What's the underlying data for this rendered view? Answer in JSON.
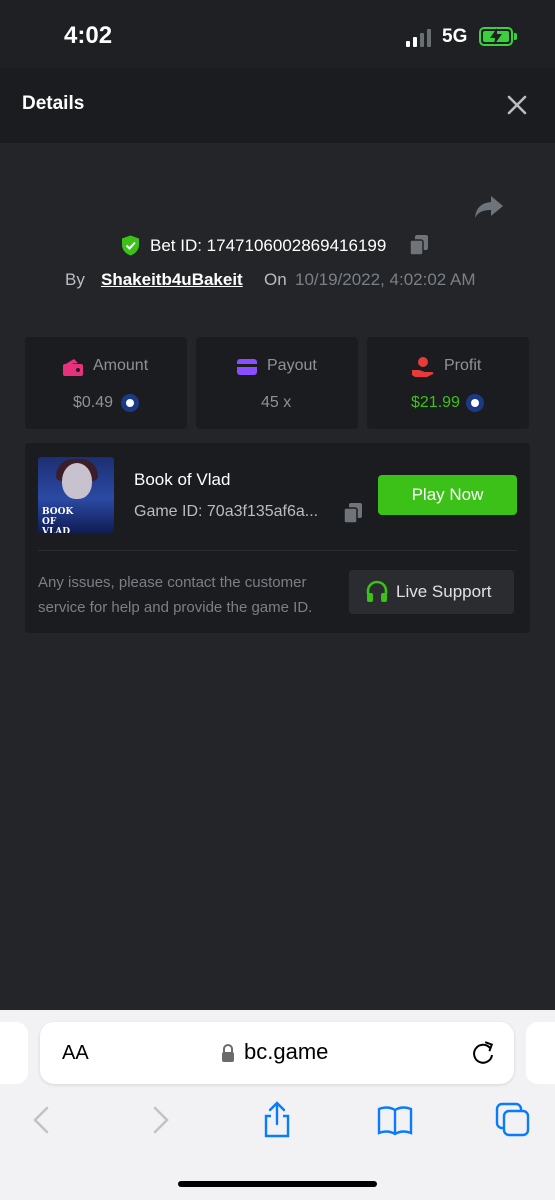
{
  "status": {
    "time": "4:02",
    "network": "5G"
  },
  "header": {
    "title": "Details"
  },
  "bet": {
    "id_label": "Bet ID: 1747106002869416199",
    "by_label": "By",
    "username": "Shakeitb4uBakeit",
    "on_label": "On",
    "datetime": "10/19/2022, 4:02:02 AM"
  },
  "stats": {
    "amount": {
      "label": "Amount",
      "value": "$0.49",
      "icon": "wallet-icon"
    },
    "payout": {
      "label": "Payout",
      "value": "45 x",
      "icon": "card-icon"
    },
    "profit": {
      "label": "Profit",
      "value": "$21.99",
      "icon": "hand-coin-icon"
    }
  },
  "game": {
    "title": "Book of Vlad",
    "id_label": "Game ID: 70a3f135af6a...",
    "thumb_text": "BOOK OF VLAD",
    "play_label": "Play Now",
    "issues_text": "Any issues, please contact the customer service for help and provide the game ID.",
    "support_label": "Live Support"
  },
  "browser": {
    "text_size": "AA",
    "url": "bc.game"
  },
  "colors": {
    "accent_green": "#3bc117",
    "profit_green": "#3bc117",
    "shield_green": "#3bc117",
    "amount_pink": "#e8317c",
    "payout_purple": "#8a4dff",
    "profit_red": "#e73a3a",
    "ios_blue": "#0a7aff"
  }
}
